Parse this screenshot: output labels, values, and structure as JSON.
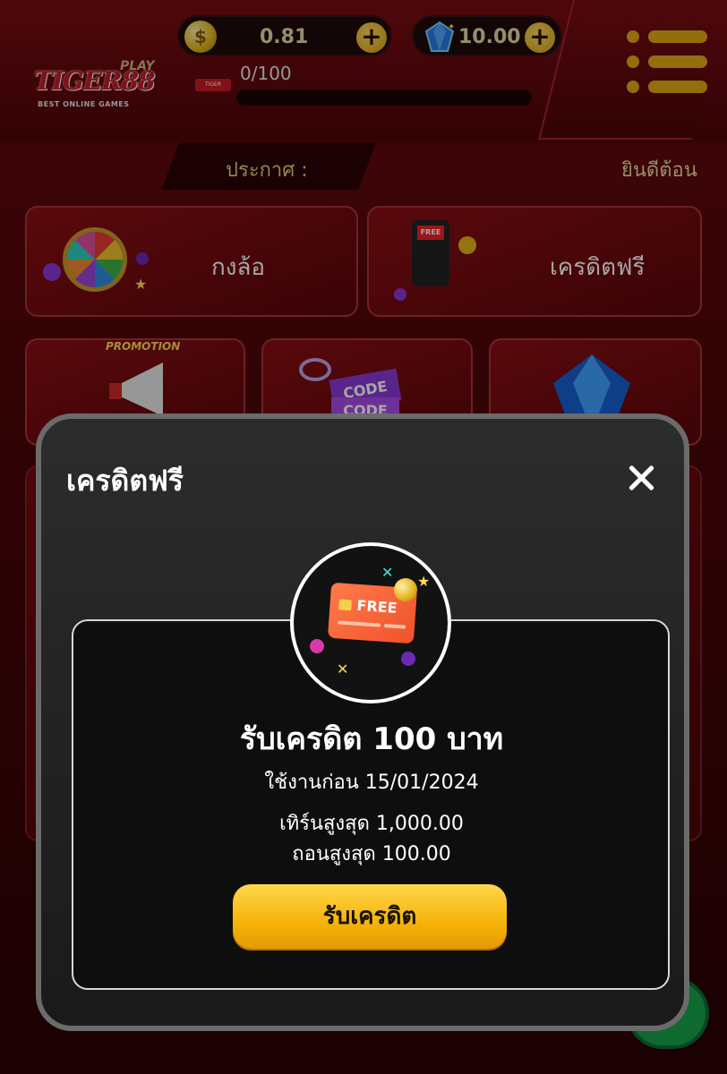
{
  "header": {
    "logo": {
      "brand": "TIGER88",
      "play": "PLAY",
      "tagline": "BEST ONLINE GAMES"
    },
    "coins": {
      "value": "0.81",
      "icon": "coin-icon",
      "add_icon": "plus-icon"
    },
    "gems": {
      "value": "10.00",
      "icon": "gem-icon",
      "add_icon": "plus-icon"
    },
    "level_progress": {
      "label": "0/100",
      "fraction": 0.0
    },
    "menu_icon": "hamburger-menu-icon",
    "accent_color": "#e2a914"
  },
  "announcement": {
    "label": "ประกาศ :",
    "text": "ยินดีต้อน"
  },
  "menu_cards": {
    "wheel": {
      "label": "กงล้อ",
      "icon": "fortune-wheel-icon"
    },
    "free_credit": {
      "label": "เครดิตฟรี",
      "icon": "payment-terminal-icon",
      "badge": "FREE"
    },
    "promotion": {
      "badge": "PROMOTION",
      "icon": "megaphone-icon"
    },
    "code": {
      "text1": "CODE",
      "text2": "CODE",
      "icon": "ticket-icon"
    },
    "diamond": {
      "icon": "diamond-icon"
    }
  },
  "modal": {
    "title": "เครดิตฟรี",
    "close_icon": "close-icon",
    "illustration": {
      "icon": "credit-card-icon",
      "card_text": "FREE"
    },
    "reward_title": "รับเครดิต 100 บาท",
    "expiry": "ใช้งานก่อน 15/01/2024",
    "turnover": "เทิร์นสูงสุด 1,000.00",
    "max_withdraw": "ถอนสูงสุด 100.00",
    "claim_button": "รับเครดิต",
    "claim_color": "#f5b30a"
  }
}
